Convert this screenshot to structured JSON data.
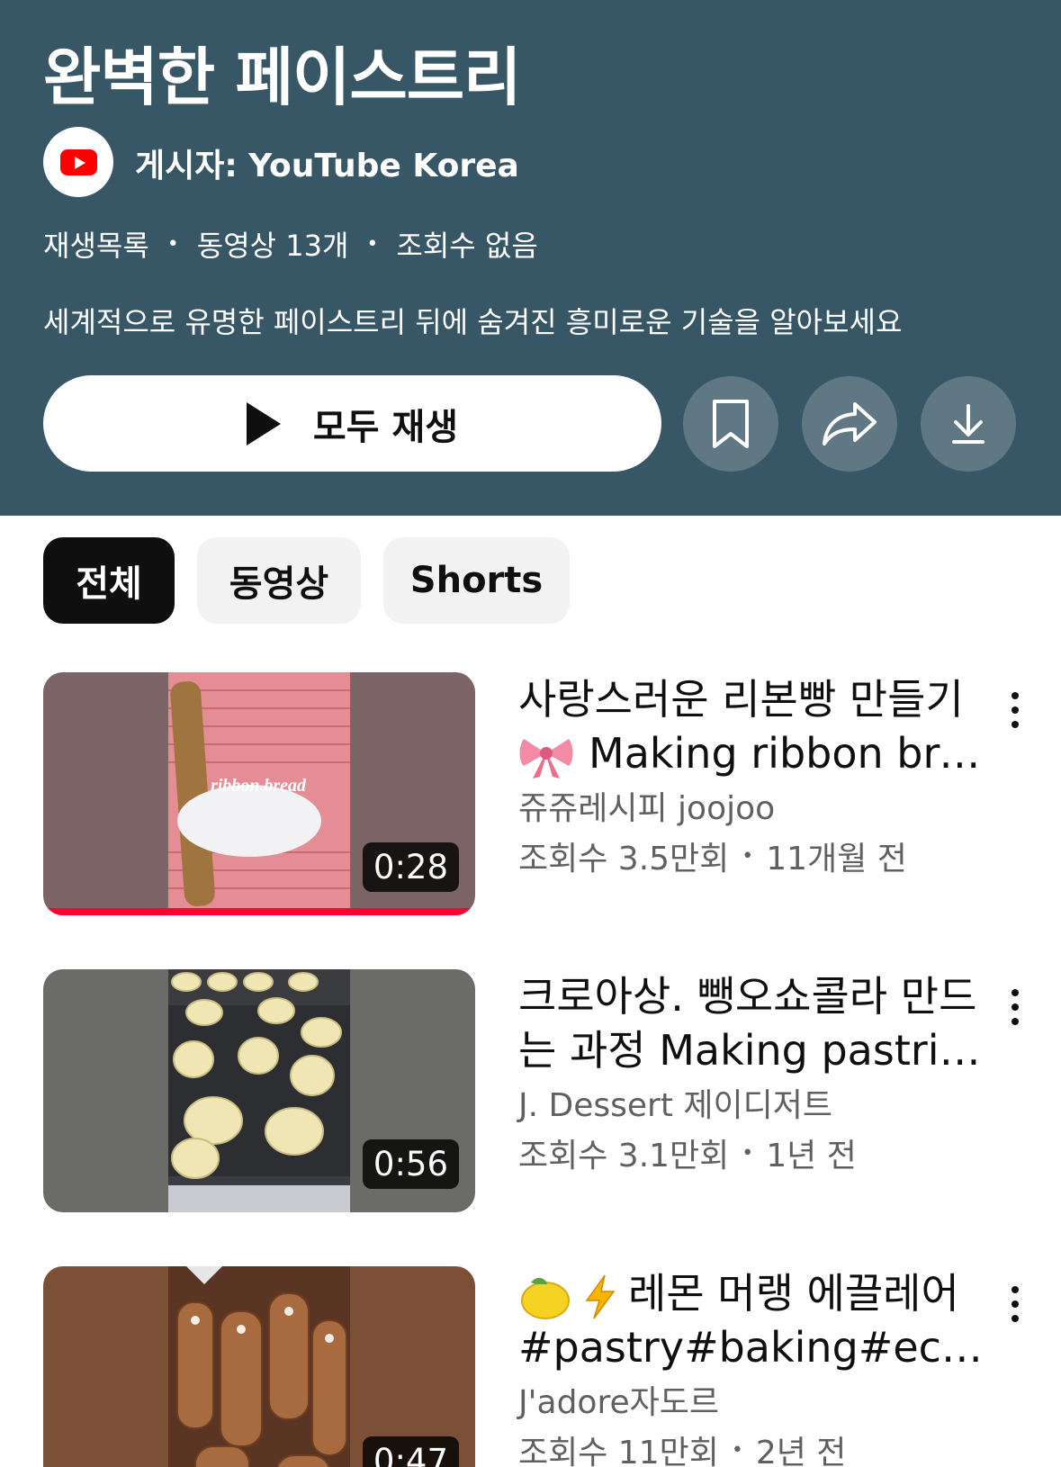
{
  "playlist": {
    "title": "완벽한 페이스트리",
    "channel": "게시자: YouTube Korea",
    "meta": [
      "재생목록",
      "동영상 13개",
      "조회수 없음"
    ],
    "description": "세계적으로 유명한 페이스트리 뒤에 숨겨진 흥미로운 기술을 알아보세요",
    "play_all": "모두 재생",
    "header_color": "#375766"
  },
  "filters": [
    {
      "label": "전체",
      "active": true
    },
    {
      "label": "동영상",
      "active": false
    },
    {
      "label": "Shorts",
      "active": false
    }
  ],
  "videos": [
    {
      "title_line1": "사랑스러운 리본빵 만들기",
      "title_line2": "Making ribbon bre...",
      "title_line2_emoji": "bow-emoji",
      "channel": "쥬쥬레시피 joojoo",
      "views": "조회수 3.5만회",
      "age": "11개월 전",
      "duration": "0:28",
      "watched_fraction": 1.0,
      "thumb_caption": "ribbon bread"
    },
    {
      "title_line1": "크로아상. 뺑오쇼콜라 만드",
      "title_line2": "는 과정 Making pastrie...",
      "channel": "J. Dessert 제이디저트",
      "views": "조회수 3.1만회",
      "age": "1년 전",
      "duration": "0:56"
    },
    {
      "title_line1": "레몬 머랭 에끌레어",
      "title_line1_emoji": [
        "lemon-emoji",
        "lightning-emoji"
      ],
      "title_line2": "#pastry#baking#eclai...",
      "channel": "J'adore자도르",
      "views": "조회수 11만회",
      "age": "2년 전",
      "duration": "0:47"
    }
  ]
}
